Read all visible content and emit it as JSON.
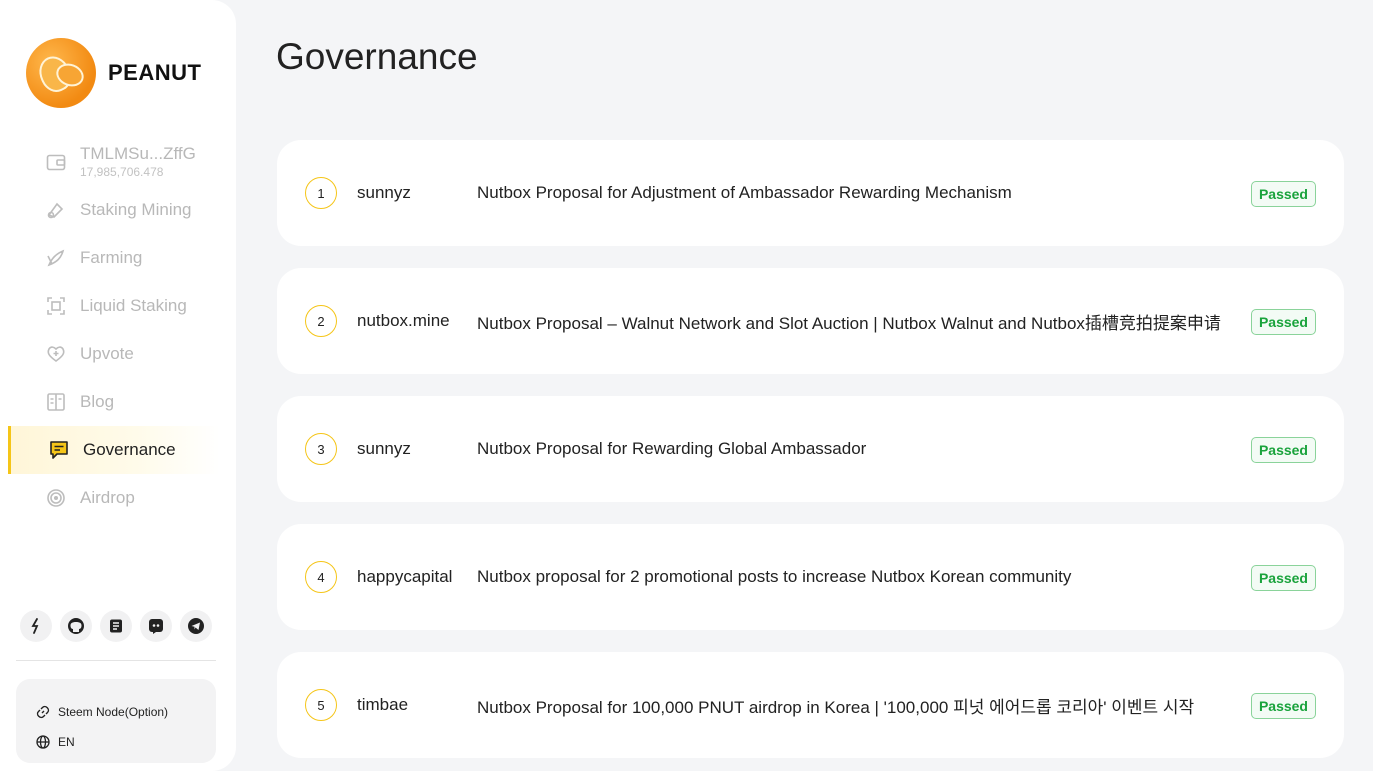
{
  "app": {
    "brand": "PEANUT"
  },
  "wallet": {
    "address": "TMLMSu...ZffG",
    "balance": "17,985,706.478"
  },
  "nav": [
    {
      "label": "Staking Mining",
      "icon": "staking-icon"
    },
    {
      "label": "Farming",
      "icon": "farming-icon"
    },
    {
      "label": "Liquid Staking",
      "icon": "liquid-staking-icon"
    },
    {
      "label": "Upvote",
      "icon": "upvote-icon"
    },
    {
      "label": "Blog",
      "icon": "blog-icon"
    },
    {
      "label": "Governance",
      "icon": "governance-icon",
      "active": true
    },
    {
      "label": "Airdrop",
      "icon": "airdrop-icon"
    }
  ],
  "socials": [
    "steem-icon",
    "github-icon",
    "medium-icon",
    "discord-icon",
    "telegram-icon"
  ],
  "settings": {
    "node": "Steem Node(Option)",
    "language": "EN"
  },
  "page": {
    "title": "Governance"
  },
  "proposals": [
    {
      "num": "1",
      "author": "sunnyz",
      "title": "Nutbox Proposal for Adjustment of Ambassador Rewarding Mechanism",
      "status": "Passed"
    },
    {
      "num": "2",
      "author": "nutbox.mine",
      "title": "Nutbox Proposal – Walnut Network and Slot Auction | Nutbox Walnut and Nutbox插槽竞拍提案申请",
      "status": "Passed"
    },
    {
      "num": "3",
      "author": "sunnyz",
      "title": "Nutbox Proposal for Rewarding Global Ambassador",
      "status": "Passed"
    },
    {
      "num": "4",
      "author": "happycapital",
      "title": "Nutbox proposal for 2 promotional posts to increase Nutbox Korean community",
      "status": "Passed"
    },
    {
      "num": "5",
      "author": "timbae",
      "title": "Nutbox Proposal for 100,000 PNUT airdrop in Korea | '100,000 피넛 에어드롭 코리아' 이벤트 시작",
      "status": "Passed"
    }
  ],
  "colors": {
    "accent": "#f5c518",
    "passed": "#1aa33c",
    "brand_orange": "#f28a12"
  }
}
